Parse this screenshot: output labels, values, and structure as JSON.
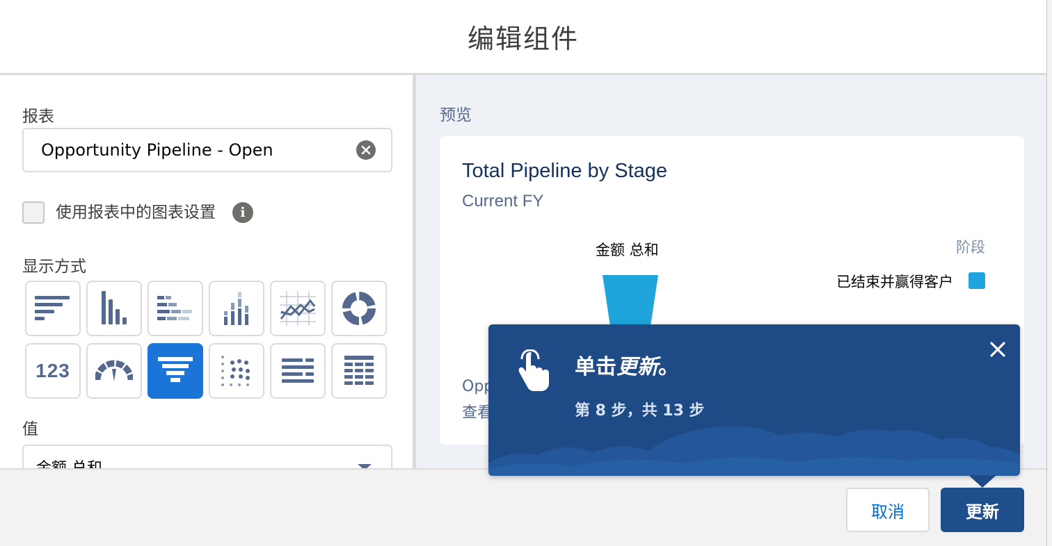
{
  "modal": {
    "title": "编辑组件"
  },
  "left": {
    "report_label": "报表",
    "report_value": "Opportunity Pipeline - Open",
    "use_chart_settings_label": "使用报表中的图表设置",
    "display_as_label": "显示方式",
    "display_tiles": [
      {
        "name": "horizontal-bar-chart-icon"
      },
      {
        "name": "vertical-bar-chart-icon"
      },
      {
        "name": "stacked-horizontal-bar-icon"
      },
      {
        "name": "stacked-vertical-bar-icon"
      },
      {
        "name": "line-chart-icon"
      },
      {
        "name": "donut-chart-icon"
      },
      {
        "name": "metric-icon",
        "text": "123"
      },
      {
        "name": "gauge-icon"
      },
      {
        "name": "funnel-chart-icon",
        "selected": true
      },
      {
        "name": "scatter-chart-icon"
      },
      {
        "name": "list-table-icon"
      },
      {
        "name": "grid-table-icon"
      }
    ],
    "value_label": "值",
    "value_selected": "金额 总和"
  },
  "right": {
    "preview_label": "预览",
    "card_title": "Total Pipeline by Stage",
    "card_subtitle": "Current FY",
    "measure_label": "金额 总和",
    "legend_title": "阶段",
    "legend_item": "已结束并赢得客户",
    "legend_color": "#1fa4dc",
    "footnote_line1": "Opp",
    "footnote_line2": "查看"
  },
  "footer": {
    "cancel_label": "取消",
    "update_label": "更新"
  },
  "tour": {
    "title_prefix": "单击",
    "title_emphasis": "更新",
    "title_suffix": "。",
    "step_text": "第 8 步，共 13 步",
    "bg_color": "#1e4a85"
  }
}
